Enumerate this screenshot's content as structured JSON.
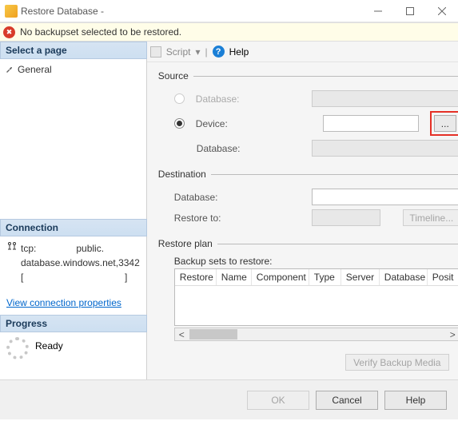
{
  "window": {
    "title": "Restore Database -"
  },
  "error": {
    "message": "No backupset selected to be restored."
  },
  "left": {
    "select_page": "Select a page",
    "pages": [
      {
        "label": "General"
      }
    ],
    "connection_head": "Connection",
    "conn_line1": "tcp:               public.",
    "conn_line2": "database.windows.net,3342",
    "conn_line3": "[                                      ]",
    "view_props": "View connection properties",
    "progress_head": "Progress",
    "progress_status": "Ready"
  },
  "toolbar": {
    "script": "Script",
    "help": "Help"
  },
  "main": {
    "source": {
      "legend": "Source",
      "database_label": "Database:",
      "device_label": "Device:",
      "db2_label": "Database:"
    },
    "dest": {
      "legend": "Destination",
      "database_label": "Database:",
      "restore_to_label": "Restore to:",
      "timeline_btn": "Timeline..."
    },
    "plan": {
      "legend": "Restore plan",
      "sets_label": "Backup sets to restore:",
      "cols": [
        "Restore",
        "Name",
        "Component",
        "Type",
        "Server",
        "Database",
        "Posit"
      ]
    },
    "verify_btn": "Verify Backup Media",
    "browse_btn": "..."
  },
  "footer": {
    "ok": "OK",
    "cancel": "Cancel",
    "help": "Help"
  }
}
